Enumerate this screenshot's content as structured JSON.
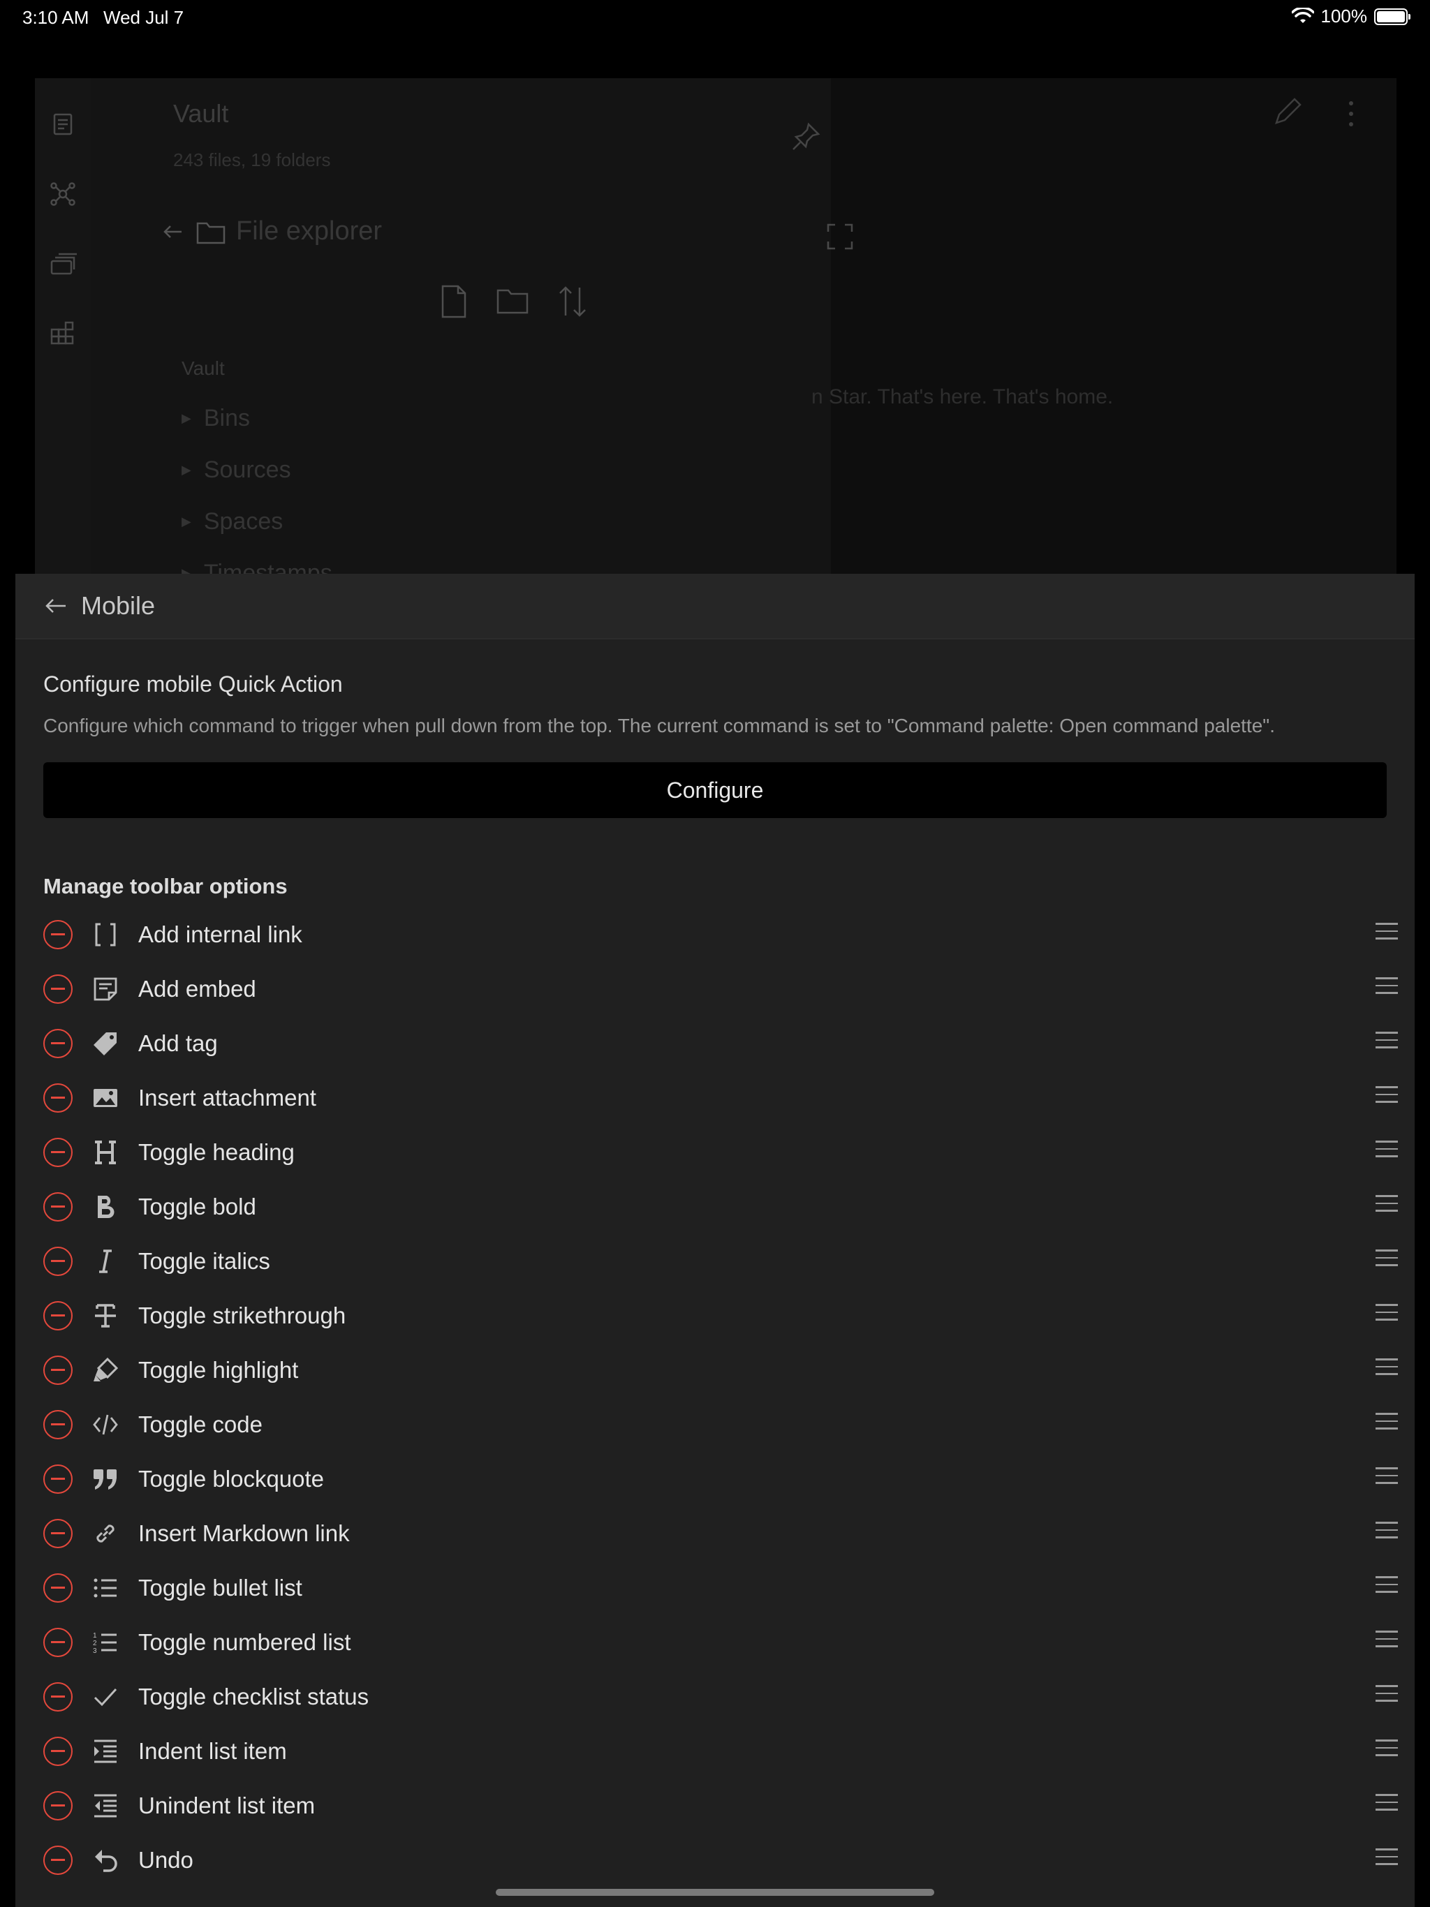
{
  "status_bar": {
    "time": "3:10 AM",
    "date": "Wed Jul 7",
    "battery": "100%",
    "battery_level": 1.0
  },
  "background": {
    "vault_title": "Vault",
    "vault_stats": "243 files, 19 folders",
    "explorer_title": "File explorer",
    "tree_root": "Vault",
    "folders": [
      "Bins",
      "Sources",
      "Spaces",
      "Timestamps"
    ],
    "note_text": "n Star. That's here. That's home."
  },
  "modal": {
    "title": "Mobile",
    "quick_action": {
      "name": "Configure mobile Quick Action",
      "description": "Configure which command to trigger when pull down from the top. The current command is set to \"Command palette: Open command palette\".",
      "button_label": "Configure"
    },
    "toolbar_section_title": "Manage toolbar options",
    "toolbar_items": [
      {
        "label": "Add internal link",
        "icon": "brackets-icon"
      },
      {
        "label": "Add embed",
        "icon": "embed-icon"
      },
      {
        "label": "Add tag",
        "icon": "tag-icon"
      },
      {
        "label": "Insert attachment",
        "icon": "image-icon"
      },
      {
        "label": "Toggle heading",
        "icon": "heading-icon"
      },
      {
        "label": "Toggle bold",
        "icon": "bold-icon"
      },
      {
        "label": "Toggle italics",
        "icon": "italic-icon"
      },
      {
        "label": "Toggle strikethrough",
        "icon": "strikethrough-icon"
      },
      {
        "label": "Toggle highlight",
        "icon": "highlighter-icon"
      },
      {
        "label": "Toggle code",
        "icon": "code-icon"
      },
      {
        "label": "Toggle blockquote",
        "icon": "quote-icon"
      },
      {
        "label": "Insert Markdown link",
        "icon": "link-icon"
      },
      {
        "label": "Toggle bullet list",
        "icon": "bullet-list-icon"
      },
      {
        "label": "Toggle numbered list",
        "icon": "numbered-list-icon"
      },
      {
        "label": "Toggle checklist status",
        "icon": "check-icon"
      },
      {
        "label": "Indent list item",
        "icon": "indent-icon"
      },
      {
        "label": "Unindent list item",
        "icon": "outdent-icon"
      },
      {
        "label": "Undo",
        "icon": "undo-icon"
      }
    ]
  }
}
